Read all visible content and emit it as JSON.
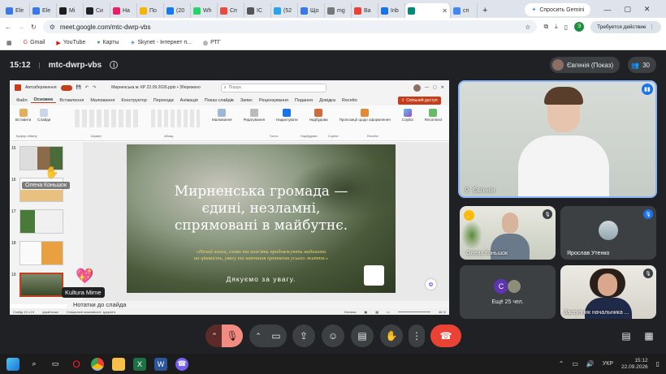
{
  "tabs": [
    {
      "label": "Ele",
      "color": "#3b78e7"
    },
    {
      "label": "Ele",
      "color": "#3b78e7"
    },
    {
      "label": "Mi",
      "color": "#1e1e1e"
    },
    {
      "label": "Си",
      "color": "#222"
    },
    {
      "label": "На",
      "color": "#e91e63"
    },
    {
      "label": "По",
      "color": "#f6b400"
    },
    {
      "label": "(20",
      "color": "#1877f2"
    },
    {
      "label": "Wh",
      "color": "#25d366"
    },
    {
      "label": "Сп",
      "color": "#e74c3c"
    },
    {
      "label": "IC",
      "color": "#555"
    },
    {
      "label": "(52",
      "color": "#2aa3ef"
    },
    {
      "label": "Що",
      "color": "#3b78e7"
    },
    {
      "label": "mg",
      "color": "#777"
    },
    {
      "label": "Ва",
      "color": "#ea4335"
    },
    {
      "label": "Inb",
      "color": "#1a73e8"
    },
    {
      "label": "",
      "color": "#00897b"
    },
    {
      "label": "сп",
      "color": "#4285f4"
    }
  ],
  "browser": {
    "new_tab": "+",
    "gemini": "Спросить Gemini",
    "url": "meet.google.com/mtc-dwrp-vbs",
    "action_required": "Требуется действие",
    "avatar_letter": "Э",
    "bookmarks": [
      "Gmail",
      "YouTube",
      "Карты",
      "Skynet - Інтернет п...",
      "РТГ"
    ]
  },
  "meet": {
    "time": "15:12",
    "separator": "|",
    "meeting_code": "mtc-dwrp-vbs",
    "presenter_chip": "Євгенія (Показ)",
    "participants_count": "30",
    "more_count": "Ещё 25 чел.",
    "more_avatar_letter": "С"
  },
  "ppt": {
    "autosave": "Автозбереження",
    "doc_title": "Мирненська м: КР 22.09.2026.pptx • Збережено",
    "search_placeholder": "Пошук",
    "share": "Спільний доступ",
    "ribbon_tabs": [
      "Файл",
      "Основне",
      "Вставлення",
      "Малювання",
      "Конструктор",
      "Переходи",
      "Анімація",
      "Показ слайдів",
      "Запис",
      "Рецензування",
      "Подання",
      "Довідка",
      "Recetto"
    ],
    "ribbon_buttons": [
      "Вставити",
      "Слайди",
      "Малювання",
      "Редагування",
      "Надиктувати",
      "Надбудови",
      "Пропозиції щодо оформлення",
      "Copilot",
      "Reconnect"
    ],
    "ribbon_groups": [
      "Буфер обміну",
      "Шрифт",
      "Абзац",
      "Голос",
      "Надбудови",
      "Copilot",
      "Recetto"
    ],
    "slide_numbers": [
      "15",
      "16",
      "17",
      "18",
      "19"
    ],
    "notes": "Нотатки до слайда",
    "status_left": "Слайд 19 з 19",
    "status_lang": "українська",
    "status_access": "Спеціальні можливості: здоров'я",
    "status_notes": "Нотатки",
    "zoom": "46 %"
  },
  "slide": {
    "title_line1": "Мирненська громада —",
    "title_line2": "єдині, незламні,",
    "title_line3": "спрямовані в майбутнє.",
    "quote_line1": "«Нехай книги, слово та пам'ять продовжують надихати",
    "quote_line2": "на цікавість, увагу та навчання протягом усього життя.»",
    "thanks": "Дякуємо за увагу."
  },
  "overlay": {
    "name_konyshok": "Олена Коньшок",
    "name_kultura": "Kultura Mirne"
  },
  "tiles": {
    "main_name": "Євгенія",
    "olena_name": "Олена Коньшок",
    "yaroslav_name": "Ярослав Утенко",
    "nach_name": "Заступник начальника ..."
  },
  "taskbar": {
    "lang": "УКР",
    "clock_time": "15:12",
    "clock_date": "22.09.2026"
  },
  "colors": {
    "meet_bg": "#202124",
    "leave_red": "#ea4335",
    "mic_off_red": "#f28b82",
    "ppt_orange": "#c43e1c",
    "accent_blue": "#8ab4f8"
  }
}
